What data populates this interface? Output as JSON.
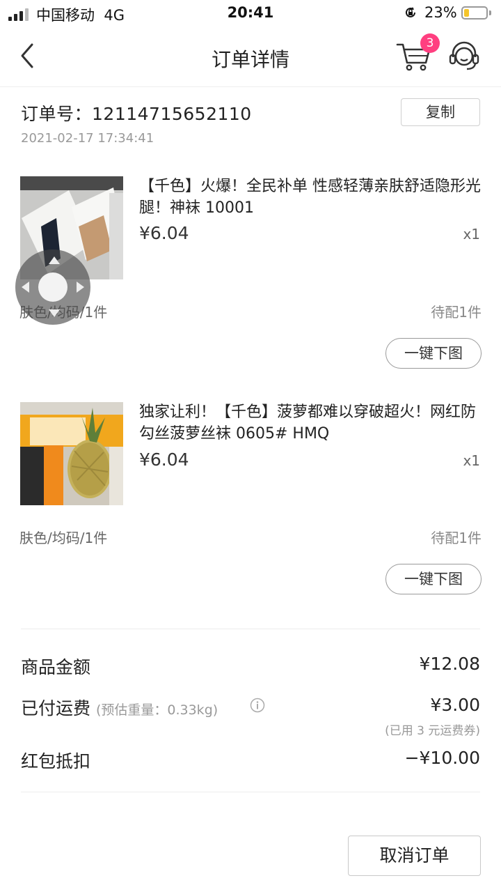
{
  "status_bar": {
    "carrier": "中国移动",
    "network": "4G",
    "time": "20:41",
    "battery_pct": "23%",
    "battery_level": 0.23,
    "battery_color": "#f5c52b"
  },
  "nav": {
    "back_icon": "chevron-left-icon",
    "title": "订单详情",
    "cart_icon": "cart-icon",
    "cart_badge": "3",
    "service_icon": "customer-service-icon",
    "badge_color": "#ff3f80"
  },
  "order": {
    "number_label": "订单号：",
    "number": "12114715652110",
    "time": "2021-02-17 17:34:41",
    "copy_label": "复制"
  },
  "products": [
    {
      "title": "【千色】火爆！全民补单 性感轻薄亲肤舒适隐形光腿！神袜 10001",
      "price": "¥6.04",
      "qty": "x1",
      "spec": "肤色/均码/1件",
      "status": "待配1件",
      "action": "一键下图",
      "image": "stockings-product-photo"
    },
    {
      "title": "独家让利！【千色】菠萝都难以穿破超火！网红防勾丝菠萝丝袜  0605#  HMQ",
      "price": "¥6.04",
      "qty": "x1",
      "spec": "肤色/均码/1件",
      "status": "待配1件",
      "action": "一键下图",
      "image": "pineapple-product-photo"
    }
  ],
  "summary": {
    "goods_label": "商品金额",
    "goods_value": "¥12.08",
    "shipping_label": "已付运费",
    "shipping_note": "(预估重量：0.33kg)",
    "shipping_value": "¥3.00",
    "shipping_sub": "(已用 3 元运费券)",
    "redpacket_label": "红包抵扣",
    "redpacket_value": "−¥10.00"
  },
  "footer": {
    "cancel_label": "取消订单"
  }
}
